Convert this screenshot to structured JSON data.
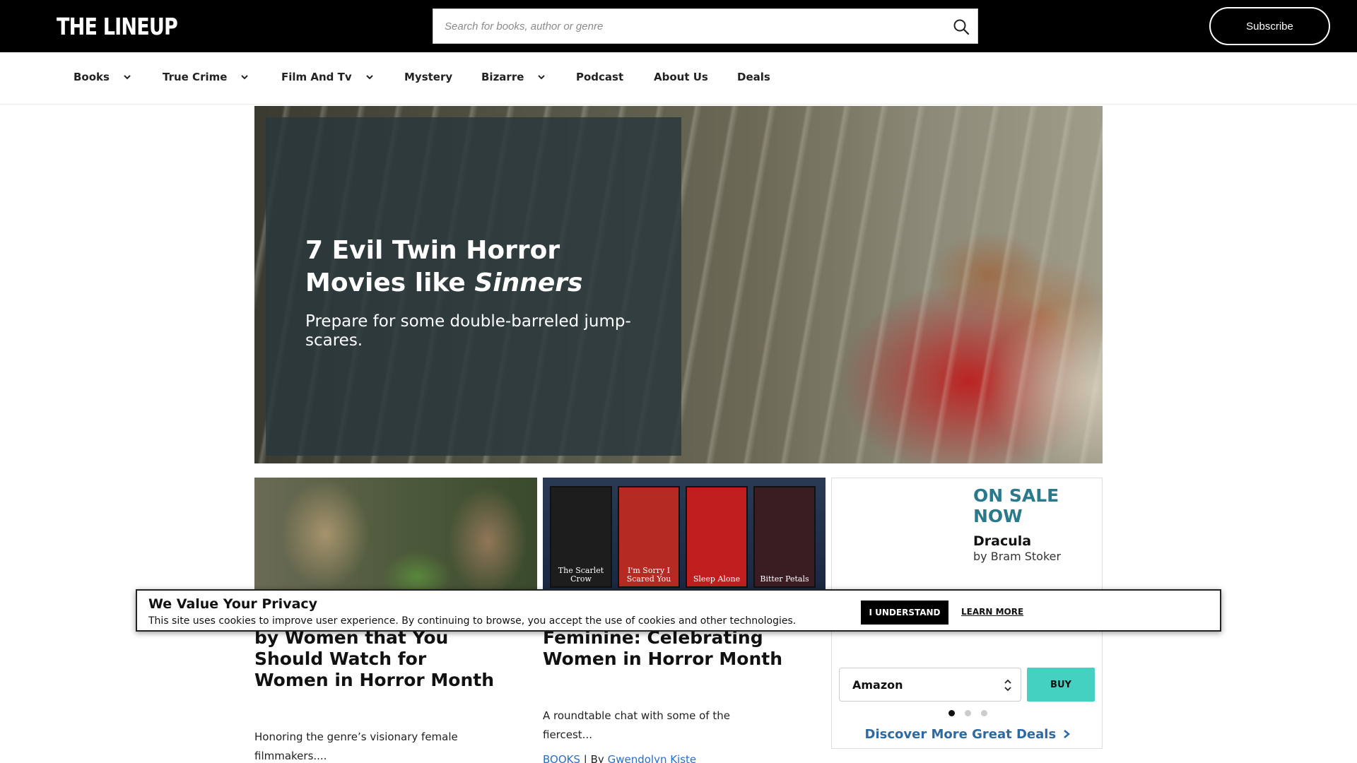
{
  "header": {
    "logo": "THE LINEUP",
    "search_placeholder": "Search for books, author or genre",
    "subscribe_label": "Subscribe"
  },
  "nav": {
    "items": [
      {
        "label": "Books",
        "dropdown": true
      },
      {
        "label": "True Crime",
        "dropdown": true
      },
      {
        "label": "Film And Tv",
        "dropdown": true
      },
      {
        "label": "Mystery",
        "dropdown": false
      },
      {
        "label": "Bizarre",
        "dropdown": true
      },
      {
        "label": "Podcast",
        "dropdown": false
      },
      {
        "label": "About Us",
        "dropdown": false
      },
      {
        "label": "Deals",
        "dropdown": false
      }
    ]
  },
  "hero": {
    "title_main": "7 Evil Twin Horror Movies like ",
    "title_italic": "Sinners",
    "subtitle": "Prepare for some double-barreled jump-scares."
  },
  "cards": [
    {
      "title": "by Women that You Should Watch for Women in Horror Month",
      "description": "Honoring the genre’s visionary female filmmakers...."
    },
    {
      "title": "Feminine: Celebrating Women in Horror Month",
      "description": "A roundtable chat with some of the fiercest...",
      "category": "BOOKS",
      "separator": "|",
      "by": "By",
      "author": "Gwendolyn Kiste"
    }
  ],
  "books_strip": [
    {
      "title": "The Scarlet Crow",
      "color": "#1d1d1d"
    },
    {
      "title": "I'm Sorry I Scared You",
      "color": "#b52a22"
    },
    {
      "title": "Sleep Alone",
      "color": "#c01e1e"
    },
    {
      "title": "Bitter Petals",
      "color": "#3a1d22"
    }
  ],
  "sale": {
    "flag": "ON SALE NOW",
    "book_title": "Dracula",
    "book_author": "by Bram Stoker",
    "retailer_selected": "Amazon",
    "buy_label": "BUY",
    "discover_label": "Discover More Great Deals",
    "dots": [
      true,
      false,
      false
    ]
  },
  "cookie": {
    "title": "We Value Your Privacy",
    "text": "This site uses cookies to improve user experience. By continuing to browse, you accept the use of cookies and other technologies.",
    "understand_label": "I UNDERSTAND",
    "learn_more_label": "LEARN MORE"
  },
  "colors": {
    "header_bg": "#000000",
    "link_blue": "#2a6ec6",
    "sale_teal": "#2a7a8c",
    "buy_teal": "#45d1c1",
    "discover_blue": "#2e6aa0"
  }
}
